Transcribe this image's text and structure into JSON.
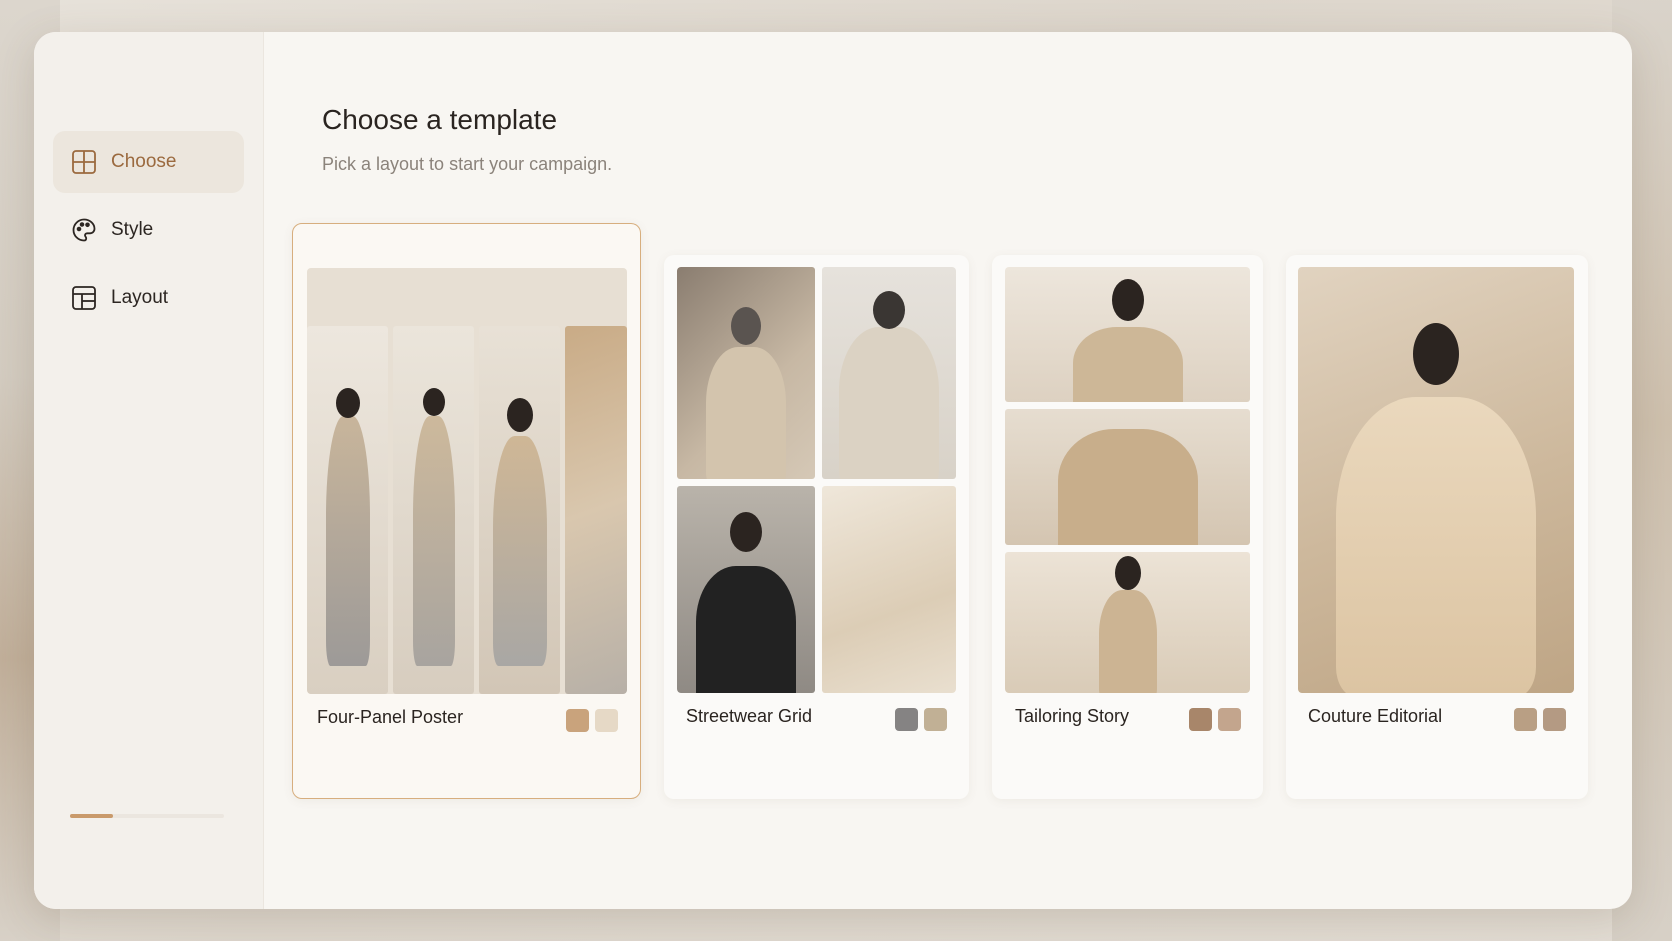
{
  "header": {
    "title": "Choose a template",
    "subtitle": "Pick a layout to start your campaign."
  },
  "sidebar": {
    "items": [
      {
        "label": "Choose",
        "icon": "grid-icon",
        "active": true
      },
      {
        "label": "Style",
        "icon": "palette-icon",
        "active": false
      },
      {
        "label": "Layout",
        "icon": "layout-icon",
        "active": false
      }
    ],
    "progress": 0.28
  },
  "templates": [
    {
      "name": "Four-Panel Poster",
      "selected": true,
      "swatches": [
        "#c9a37c",
        "#e6d9c6"
      ]
    },
    {
      "name": "Streetwear Grid",
      "selected": false,
      "swatches": [
        "#858383",
        "#c1b095"
      ]
    },
    {
      "name": "Tailoring Story",
      "selected": false,
      "swatches": [
        "#a8866a",
        "#c3a58d"
      ]
    },
    {
      "name": "Couture Editorial",
      "selected": false,
      "swatches": [
        "#b99f84",
        "#b49a83"
      ]
    }
  ],
  "colors": {
    "accent": "#9b6a3f",
    "selected_border": "#d7ae7e"
  }
}
